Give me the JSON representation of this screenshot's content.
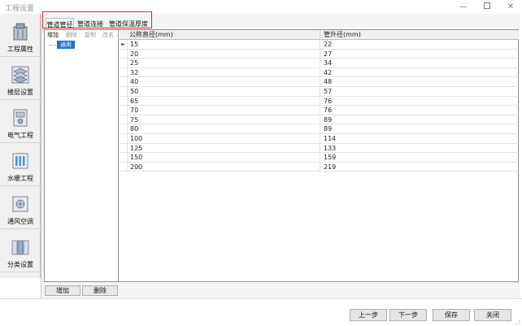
{
  "window": {
    "title": "工程设置",
    "min_symbol": "—",
    "close_symbol": "✕"
  },
  "sidebar": {
    "items": [
      {
        "label": "工程属性",
        "icon": "building-icon"
      },
      {
        "label": "楼层设置",
        "icon": "floors-icon"
      },
      {
        "label": "电气工程",
        "icon": "electrical-icon"
      },
      {
        "label": "水暖工程",
        "icon": "plumbing-icon"
      },
      {
        "label": "通风空调",
        "icon": "hvac-icon"
      },
      {
        "label": "分类设置",
        "icon": "classify-icon"
      }
    ]
  },
  "tabs": [
    {
      "label": "管道管径",
      "active": true
    },
    {
      "label": "管道连接",
      "active": false
    },
    {
      "label": "管道保温厚度",
      "active": false
    }
  ],
  "tree": {
    "toolbar": [
      "增加",
      "删除",
      "复制",
      "改名"
    ],
    "node": "通用"
  },
  "grid": {
    "columns": [
      "公称直径(mm)",
      "管外径(mm)"
    ],
    "current_row_marker": "►",
    "rows": [
      [
        "15",
        "22"
      ],
      [
        "20",
        "27"
      ],
      [
        "25",
        "34"
      ],
      [
        "32",
        "42"
      ],
      [
        "40",
        "48"
      ],
      [
        "50",
        "57"
      ],
      [
        "65",
        "76"
      ],
      [
        "70",
        "76"
      ],
      [
        "75",
        "89"
      ],
      [
        "80",
        "89"
      ],
      [
        "100",
        "114"
      ],
      [
        "125",
        "133"
      ],
      [
        "150",
        "159"
      ],
      [
        "200",
        "219"
      ]
    ]
  },
  "panel_buttons": {
    "add": "增加",
    "delete": "删除"
  },
  "footer": {
    "prev": "上一步",
    "next": "下一步",
    "save": "保存",
    "close": "关闭"
  },
  "colors": {
    "highlight": "#e02424",
    "selection": "#1872d8"
  }
}
